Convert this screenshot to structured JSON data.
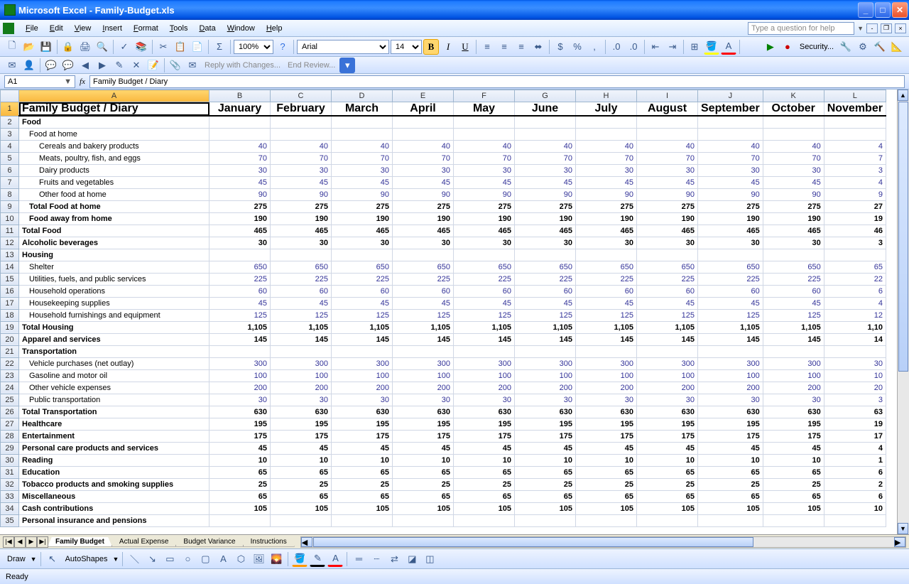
{
  "window": {
    "title": "Microsoft Excel - Family-Budget.xls"
  },
  "menus": [
    "File",
    "Edit",
    "View",
    "Insert",
    "Format",
    "Tools",
    "Data",
    "Window",
    "Help"
  ],
  "help_placeholder": "Type a question for help",
  "zoom": "100%",
  "font_name": "Arial",
  "font_size": "14",
  "security_label": "Security...",
  "review": {
    "reply": "Reply with Changes...",
    "end": "End Review..."
  },
  "namebox": "A1",
  "formula": "Family Budget / Diary",
  "columns": [
    "A",
    "B",
    "C",
    "D",
    "E",
    "F",
    "G",
    "H",
    "I",
    "J",
    "K",
    "L"
  ],
  "months": [
    "January",
    "February",
    "March",
    "April",
    "May",
    "June",
    "July",
    "August",
    "September",
    "October",
    "November"
  ],
  "rows": [
    {
      "n": 1,
      "label": "Family Budget / Diary",
      "style": "title"
    },
    {
      "n": 2,
      "label": "Food",
      "style": "bold"
    },
    {
      "n": 3,
      "label": "Food at home",
      "indent": 1
    },
    {
      "n": 4,
      "label": "Cereals and bakery products",
      "indent": 2,
      "val": 40
    },
    {
      "n": 5,
      "label": "Meats, poultry, fish, and eggs",
      "indent": 2,
      "val": 70
    },
    {
      "n": 6,
      "label": "Dairy products",
      "indent": 2,
      "val": 30
    },
    {
      "n": 7,
      "label": "Fruits and vegetables",
      "indent": 2,
      "val": 45
    },
    {
      "n": 8,
      "label": "Other food at home",
      "indent": 2,
      "val": 90
    },
    {
      "n": 9,
      "label": "Total Food at home",
      "style": "bold",
      "indent": 1,
      "val": 275,
      "bval": 275
    },
    {
      "n": 10,
      "label": "Food away from home",
      "style": "bold",
      "indent": 1,
      "val": 190,
      "bval": 190
    },
    {
      "n": 11,
      "label": "Total Food",
      "style": "bold",
      "val": 465,
      "bval": 465
    },
    {
      "n": 12,
      "label": "Alcoholic beverages",
      "style": "bold",
      "val": 30
    },
    {
      "n": 13,
      "label": "Housing",
      "style": "bold"
    },
    {
      "n": 14,
      "label": "Shelter",
      "indent": 1,
      "val": 650
    },
    {
      "n": 15,
      "label": "Utilities, fuels, and public services",
      "indent": 1,
      "val": 225
    },
    {
      "n": 16,
      "label": "Household operations",
      "indent": 1,
      "val": 60
    },
    {
      "n": 17,
      "label": "Housekeeping supplies",
      "indent": 1,
      "val": 45
    },
    {
      "n": 18,
      "label": "Household furnishings and equipment",
      "indent": 1,
      "val": 125
    },
    {
      "n": 19,
      "label": "Total Housing",
      "style": "bold",
      "val": "1,105",
      "bval": "1,105"
    },
    {
      "n": 20,
      "label": "Apparel and services",
      "style": "bold",
      "val": 145,
      "bval": 145
    },
    {
      "n": 21,
      "label": "Transportation",
      "style": "bold"
    },
    {
      "n": 22,
      "label": "Vehicle purchases (net outlay)",
      "indent": 1,
      "val": 300
    },
    {
      "n": 23,
      "label": "Gasoline and motor oil",
      "indent": 1,
      "val": 100
    },
    {
      "n": 24,
      "label": "Other vehicle expenses",
      "indent": 1,
      "val": 200
    },
    {
      "n": 25,
      "label": "Public transportation",
      "indent": 1,
      "val": 30
    },
    {
      "n": 26,
      "label": "Total Transportation",
      "style": "bold",
      "val": 630,
      "bval": 630
    },
    {
      "n": 27,
      "label": "Healthcare",
      "style": "bold",
      "val": 195,
      "bval": 195
    },
    {
      "n": 28,
      "label": "Entertainment",
      "style": "bold",
      "val": 175,
      "bval": 175
    },
    {
      "n": 29,
      "label": "Personal care products and services",
      "style": "bold",
      "val": 45,
      "bval": 45
    },
    {
      "n": 30,
      "label": "Reading",
      "style": "bold",
      "val": 10,
      "bval": 10
    },
    {
      "n": 31,
      "label": "Education",
      "style": "bold",
      "val": 65,
      "bval": 65
    },
    {
      "n": 32,
      "label": "Tobacco products and smoking supplies",
      "style": "bold",
      "val": 25,
      "bval": 25
    },
    {
      "n": 33,
      "label": "Miscellaneous",
      "style": "bold",
      "val": 65,
      "bval": 65
    },
    {
      "n": 34,
      "label": "Cash contributions",
      "style": "bold",
      "val": 105,
      "bval": 105
    },
    {
      "n": 35,
      "label": "Personal insurance and pensions",
      "style": "bold"
    }
  ],
  "tabs": [
    "Family Budget",
    "Actual Expense",
    "Budget Variance",
    "Instructions"
  ],
  "active_tab": 0,
  "draw_label": "Draw",
  "autoshapes": "AutoShapes",
  "status": "Ready"
}
